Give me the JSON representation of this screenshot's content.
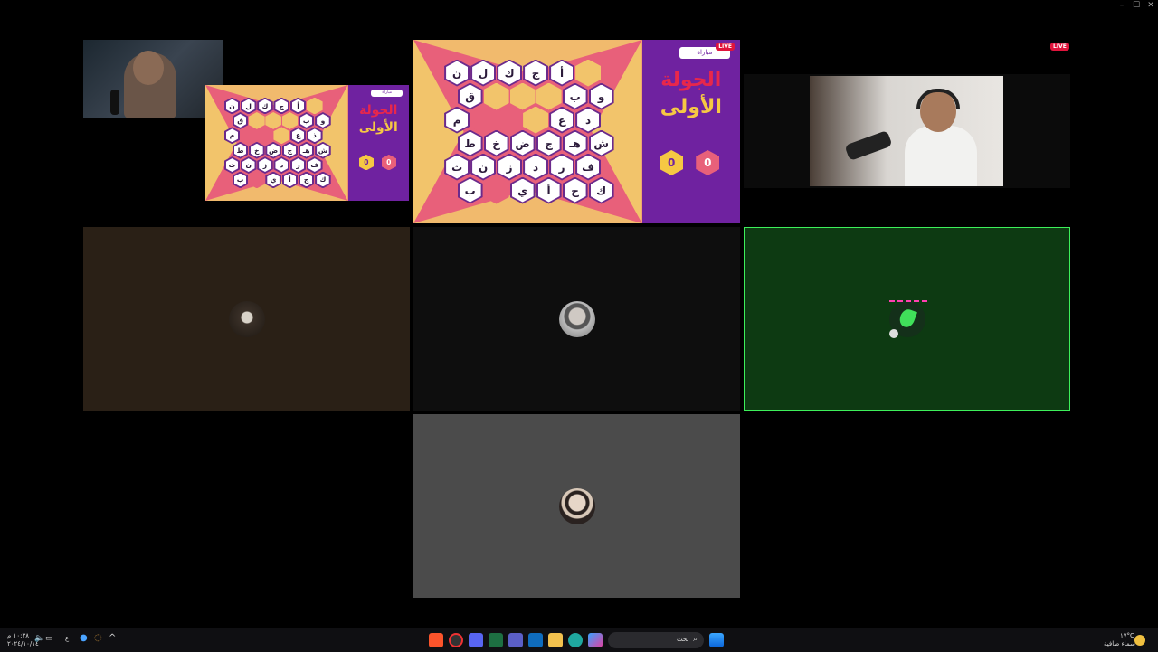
{
  "window_controls": {
    "minimize": "–",
    "maximize": "☐",
    "close": "✕"
  },
  "live_badges": {
    "main": "LIVE",
    "right": "LIVE"
  },
  "board": {
    "button_label": "مباراة",
    "round_title_line1": "الجولة",
    "round_title_line2": "الأولى",
    "score_gold": "0",
    "score_pink": "0",
    "cells": [
      [
        "ن",
        "ل",
        "ك",
        "ج",
        "أ",
        ""
      ],
      [
        "ق",
        "",
        "",
        "",
        "ب",
        "و"
      ],
      [
        "م",
        "",
        "",
        "",
        "ع",
        "ذ"
      ],
      [
        "ط",
        "خ",
        "ض",
        "ج",
        "هـ",
        "ش"
      ],
      [
        "ث",
        "ن",
        "ز",
        "د",
        "ر",
        "ف"
      ],
      [
        "ب",
        "",
        "ي",
        "أ",
        "ج",
        "ك"
      ]
    ],
    "cell_types": [
      [
        "w",
        "w",
        "w",
        "w",
        "w",
        "g"
      ],
      [
        "w",
        "g",
        "g",
        "g",
        "w",
        "w"
      ],
      [
        "w",
        "p",
        "p",
        "g",
        "w",
        "w"
      ],
      [
        "w",
        "w",
        "w",
        "w",
        "w",
        "w"
      ],
      [
        "w",
        "w",
        "w",
        "w",
        "w",
        "w"
      ],
      [
        "w",
        "p",
        "w",
        "w",
        "w",
        "w"
      ]
    ]
  },
  "colors": {
    "board_pink": "#e8607a",
    "board_gold": "#f2c46b",
    "board_purple": "#6f22a0",
    "title_red": "#e8274b",
    "title_gold": "#f6c843",
    "tile_brown": "#2a2016",
    "tile_dark": "#0e0e0e",
    "tile_green": "#0d3a12",
    "tile_grey": "#4b4b4b",
    "speaker_border": "#3df05a"
  },
  "taskbar": {
    "search_placeholder": "بحث",
    "time": "١٠:٣٨ م",
    "date": "٢٠٢٤/١٠/١٤",
    "lang": "ع",
    "weather_temp": "١٧°C",
    "weather_desc": "سماء صافية",
    "icons": [
      "brave-icon",
      "record-icon",
      "discord-icon",
      "excel-icon",
      "teams-icon",
      "outlook-icon",
      "folder-icon",
      "edge-icon",
      "copilot-icon",
      "search-icon",
      "windows-start-icon"
    ]
  }
}
